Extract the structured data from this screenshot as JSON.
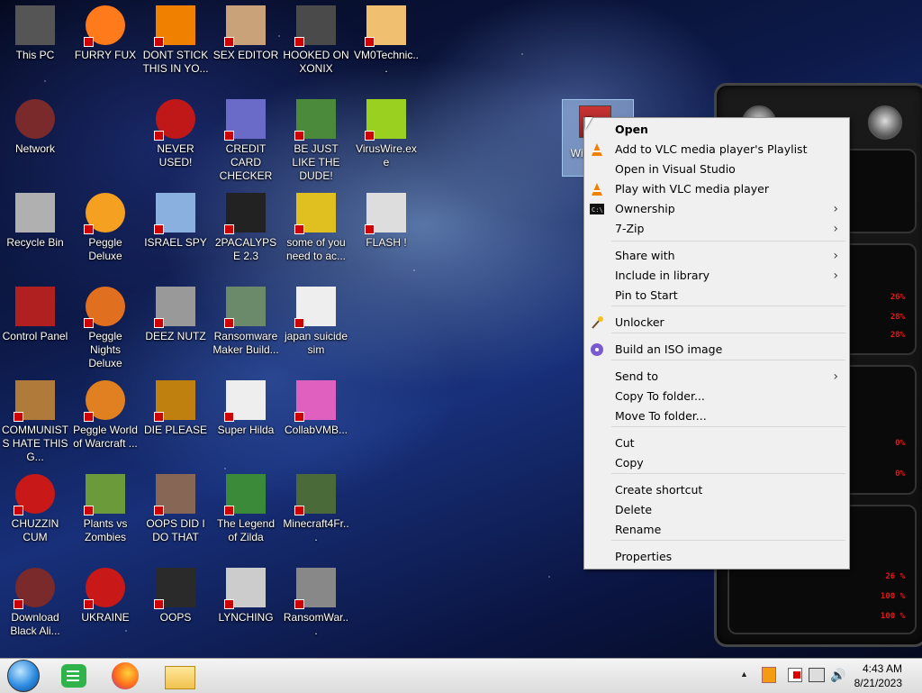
{
  "desktop": {
    "icons": [
      {
        "label": "This PC"
      },
      {
        "label": "FURRY FUX"
      },
      {
        "label": "DONT STICK THIS IN YO..."
      },
      {
        "label": "SEX EDITOR"
      },
      {
        "label": "HOOKED ON XONIX"
      },
      {
        "label": "VM0Technic..."
      },
      {
        "label": "Network"
      },
      {
        "label": "NEVER USED!"
      },
      {
        "label": "CREDIT CARD CHECKER"
      },
      {
        "label": "BE JUST LIKE THE DUDE!"
      },
      {
        "label": "VirusWire.exe"
      },
      {
        "label": "Recycle Bin"
      },
      {
        "label": "Peggle Deluxe"
      },
      {
        "label": "ISRAEL SPY"
      },
      {
        "label": "2PACALYPSE 2.3"
      },
      {
        "label": "some of you need to ac..."
      },
      {
        "label": "FLASH !"
      },
      {
        "label": "Control Panel"
      },
      {
        "label": "Peggle Nights Deluxe"
      },
      {
        "label": "DEEZ NUTZ"
      },
      {
        "label": "Ransomware Maker Build..."
      },
      {
        "label": "japan suicide sim"
      },
      {
        "label": "COMMUNISTS HATE THIS G..."
      },
      {
        "label": "Peggle World of Warcraft ..."
      },
      {
        "label": "DIE PLEASE"
      },
      {
        "label": "Super Hilda"
      },
      {
        "label": "CollabVMB..."
      },
      {
        "label": "CHUZZIN CUM"
      },
      {
        "label": "Plants vs Zombies"
      },
      {
        "label": "OOPS DID I DO THAT"
      },
      {
        "label": "The Legend of Zilda"
      },
      {
        "label": "Minecraft4Fr..."
      },
      {
        "label": "Download Black Ali..."
      },
      {
        "label": "UKRAINE"
      },
      {
        "label": "OOPS"
      },
      {
        "label": "LYNCHING"
      },
      {
        "label": "RansomWar..."
      }
    ],
    "selected_icon_label": "Win... der..."
  },
  "context_menu": {
    "items": [
      {
        "label": "Open",
        "bold": true
      },
      {
        "label": "Add to VLC media player's Playlist",
        "icon": "vlc-icon"
      },
      {
        "label": "Open in Visual Studio"
      },
      {
        "label": "Play with VLC media player",
        "icon": "vlc-icon"
      },
      {
        "label": "Ownership",
        "icon": "cmd-icon",
        "submenu": true
      },
      {
        "label": "7-Zip",
        "submenu": true
      },
      {
        "label": "Share with",
        "submenu": true
      },
      {
        "label": "Include in library",
        "submenu": true
      },
      {
        "label": "Pin to Start"
      },
      {
        "label": "Unlocker",
        "icon": "wand-icon"
      },
      {
        "label": "Build an ISO image",
        "icon": "disc-icon"
      },
      {
        "label": "Send to",
        "submenu": true
      },
      {
        "label": "Copy To folder..."
      },
      {
        "label": "Move To folder..."
      },
      {
        "label": "Cut"
      },
      {
        "label": "Copy"
      },
      {
        "label": "Create shortcut"
      },
      {
        "label": "Delete"
      },
      {
        "label": "Rename"
      },
      {
        "label": "Properties"
      }
    ]
  },
  "skin_widget": {
    "percent_lines": [
      "26%",
      "28%",
      "28%",
      "0%",
      "0%",
      "26 %",
      "100 %",
      "100 %"
    ]
  },
  "taskbar": {
    "pinned": [
      "start-orb-icon",
      "notes-icon",
      "firefox-icon",
      "file-explorer-icon"
    ],
    "tray": {
      "time": "4:43 AM",
      "date": "8/21/2023",
      "chevron": "▲"
    }
  },
  "colors": {
    "accent_red": "#e01818",
    "menu_bg": "#f0f0f0",
    "taskbar_bg": "#e6e6e6"
  }
}
